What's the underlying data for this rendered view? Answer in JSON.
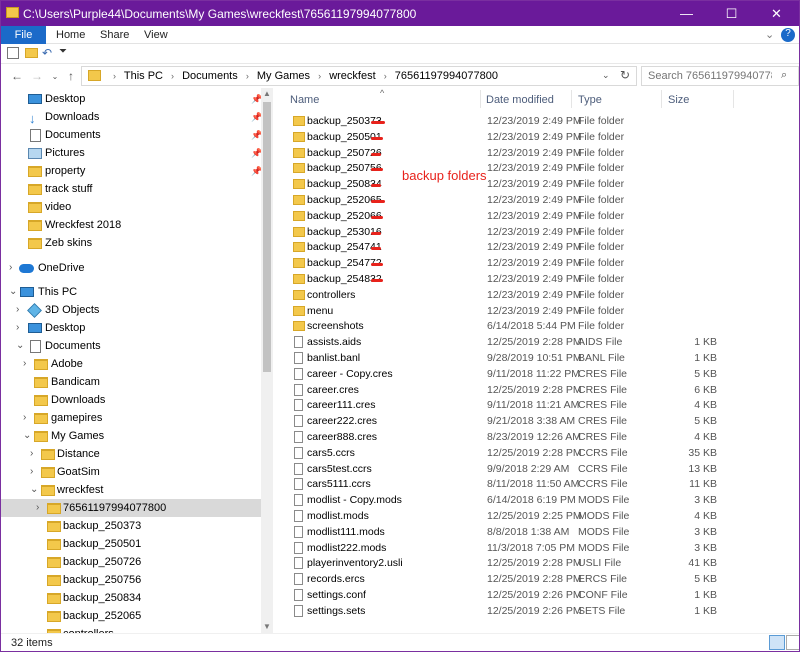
{
  "window": {
    "title": "C:\\Users\\Purple44\\Documents\\My Games\\wreckfest\\76561197994077800",
    "minimize_glyph": "—",
    "maximize_glyph": "☐",
    "close_glyph": "✕"
  },
  "ribbon": {
    "tabs": [
      "File",
      "Home",
      "Share",
      "View"
    ],
    "help_glyph": "?"
  },
  "breadcrumb": [
    "This PC",
    "Documents",
    "My Games",
    "wreckfest",
    "76561197994077800"
  ],
  "search": {
    "placeholder": "Search 76561197994077800"
  },
  "nav": {
    "quick_access": [
      {
        "label": "Desktop",
        "icon": "desktop-icon",
        "pinned": true
      },
      {
        "label": "Downloads",
        "icon": "download-icon",
        "pinned": true
      },
      {
        "label": "Documents",
        "icon": "documents-icon",
        "pinned": true
      },
      {
        "label": "Pictures",
        "icon": "pictures-icon",
        "pinned": true
      },
      {
        "label": "property",
        "icon": "folder-icon",
        "pinned": true
      },
      {
        "label": "track stuff",
        "icon": "folder-icon",
        "pinned": false
      },
      {
        "label": "video",
        "icon": "folder-icon",
        "pinned": false
      },
      {
        "label": "Wreckfest 2018",
        "icon": "folder-icon",
        "pinned": false
      },
      {
        "label": "Zeb skins",
        "icon": "folder-icon",
        "pinned": false
      }
    ],
    "onedrive": "OneDrive",
    "this_pc": "This PC",
    "tree": [
      {
        "label": "3D Objects",
        "icon": "3d-objects-icon"
      },
      {
        "label": "Desktop",
        "icon": "desktop-icon"
      },
      {
        "label": "Documents",
        "icon": "documents-icon"
      },
      {
        "label": "Adobe",
        "icon": "folder-icon"
      },
      {
        "label": "Bandicam",
        "icon": "folder-icon"
      },
      {
        "label": "Downloads",
        "icon": "folder-icon"
      },
      {
        "label": "gamepires",
        "icon": "folder-icon"
      },
      {
        "label": "My Games",
        "icon": "folder-icon"
      },
      {
        "label": "Distance",
        "icon": "folder-icon"
      },
      {
        "label": "GoatSim",
        "icon": "folder-icon"
      },
      {
        "label": "wreckfest",
        "icon": "folder-icon"
      },
      {
        "label": "76561197994077800",
        "icon": "folder-icon"
      },
      {
        "label": "backup_250373",
        "icon": "folder-icon"
      },
      {
        "label": "backup_250501",
        "icon": "folder-icon"
      },
      {
        "label": "backup_250726",
        "icon": "folder-icon"
      },
      {
        "label": "backup_250756",
        "icon": "folder-icon"
      },
      {
        "label": "backup_250834",
        "icon": "folder-icon"
      },
      {
        "label": "backup_252065",
        "icon": "folder-icon"
      },
      {
        "label": "controllers",
        "icon": "folder-icon"
      }
    ]
  },
  "columns": {
    "name": "Name",
    "date": "Date modified",
    "type": "Type",
    "size": "Size"
  },
  "files": [
    {
      "name": "backup_250373",
      "date": "12/23/2019 2:49 PM",
      "type": "File folder",
      "size": "",
      "kind": "folder"
    },
    {
      "name": "backup_250501",
      "date": "12/23/2019 2:49 PM",
      "type": "File folder",
      "size": "",
      "kind": "folder"
    },
    {
      "name": "backup_250726",
      "date": "12/23/2019 2:49 PM",
      "type": "File folder",
      "size": "",
      "kind": "folder"
    },
    {
      "name": "backup_250756",
      "date": "12/23/2019 2:49 PM",
      "type": "File folder",
      "size": "",
      "kind": "folder"
    },
    {
      "name": "backup_250834",
      "date": "12/23/2019 2:49 PM",
      "type": "File folder",
      "size": "",
      "kind": "folder"
    },
    {
      "name": "backup_252065",
      "date": "12/23/2019 2:49 PM",
      "type": "File folder",
      "size": "",
      "kind": "folder"
    },
    {
      "name": "backup_252066",
      "date": "12/23/2019 2:49 PM",
      "type": "File folder",
      "size": "",
      "kind": "folder"
    },
    {
      "name": "backup_253016",
      "date": "12/23/2019 2:49 PM",
      "type": "File folder",
      "size": "",
      "kind": "folder"
    },
    {
      "name": "backup_254741",
      "date": "12/23/2019 2:49 PM",
      "type": "File folder",
      "size": "",
      "kind": "folder"
    },
    {
      "name": "backup_254772",
      "date": "12/23/2019 2:49 PM",
      "type": "File folder",
      "size": "",
      "kind": "folder"
    },
    {
      "name": "backup_254832",
      "date": "12/23/2019 2:49 PM",
      "type": "File folder",
      "size": "",
      "kind": "folder"
    },
    {
      "name": "controllers",
      "date": "12/23/2019 2:49 PM",
      "type": "File folder",
      "size": "",
      "kind": "folder"
    },
    {
      "name": "menu",
      "date": "12/23/2019 2:49 PM",
      "type": "File folder",
      "size": "",
      "kind": "folder"
    },
    {
      "name": "screenshots",
      "date": "6/14/2018 5:44 PM",
      "type": "File folder",
      "size": "",
      "kind": "folder"
    },
    {
      "name": "assists.aids",
      "date": "12/25/2019 2:28 PM",
      "type": "AIDS File",
      "size": "1 KB",
      "kind": "file"
    },
    {
      "name": "banlist.banl",
      "date": "9/28/2019 10:51 PM",
      "type": "BANL File",
      "size": "1 KB",
      "kind": "file"
    },
    {
      "name": "career - Copy.cres",
      "date": "9/11/2018 11:22 PM",
      "type": "CRES File",
      "size": "5 KB",
      "kind": "file"
    },
    {
      "name": "career.cres",
      "date": "12/25/2019 2:28 PM",
      "type": "CRES File",
      "size": "6 KB",
      "kind": "file"
    },
    {
      "name": "career111.cres",
      "date": "9/11/2018 11:21 AM",
      "type": "CRES File",
      "size": "4 KB",
      "kind": "file"
    },
    {
      "name": "career222.cres",
      "date": "9/21/2018 3:38 AM",
      "type": "CRES File",
      "size": "5 KB",
      "kind": "file"
    },
    {
      "name": "career888.cres",
      "date": "8/23/2019 12:26 AM",
      "type": "CRES File",
      "size": "4 KB",
      "kind": "file"
    },
    {
      "name": "cars5.ccrs",
      "date": "12/25/2019 2:28 PM",
      "type": "CCRS File",
      "size": "35 KB",
      "kind": "file"
    },
    {
      "name": "cars5test.ccrs",
      "date": "9/9/2018 2:29 AM",
      "type": "CCRS File",
      "size": "13 KB",
      "kind": "file"
    },
    {
      "name": "cars5111.ccrs",
      "date": "8/11/2018 11:50 AM",
      "type": "CCRS File",
      "size": "11 KB",
      "kind": "file"
    },
    {
      "name": "modlist - Copy.mods",
      "date": "6/14/2018 6:19 PM",
      "type": "MODS File",
      "size": "3 KB",
      "kind": "file"
    },
    {
      "name": "modlist.mods",
      "date": "12/25/2019 2:25 PM",
      "type": "MODS File",
      "size": "4 KB",
      "kind": "file"
    },
    {
      "name": "modlist111.mods",
      "date": "8/8/2018 1:38 AM",
      "type": "MODS File",
      "size": "3 KB",
      "kind": "file"
    },
    {
      "name": "modlist222.mods",
      "date": "11/3/2018 7:05 PM",
      "type": "MODS File",
      "size": "3 KB",
      "kind": "file"
    },
    {
      "name": "playerinventory2.usli",
      "date": "12/25/2019 2:28 PM",
      "type": "USLI File",
      "size": "41 KB",
      "kind": "file"
    },
    {
      "name": "records.ercs",
      "date": "12/25/2019 2:28 PM",
      "type": "ERCS File",
      "size": "5 KB",
      "kind": "file"
    },
    {
      "name": "settings.conf",
      "date": "12/25/2019 2:26 PM",
      "type": "CONF File",
      "size": "1 KB",
      "kind": "file"
    },
    {
      "name": "settings.sets",
      "date": "12/25/2019 2:26 PM",
      "type": "SETS File",
      "size": "1 KB",
      "kind": "file"
    }
  ],
  "annotation": {
    "text": "backup folders",
    "color": "#e8221b"
  },
  "status": {
    "item_count": "32 items"
  },
  "colors": {
    "titlebar": "#6a1a9a",
    "file_tab": "#1b6ac9",
    "folder": "#f3c84b",
    "selection": "#d9d9d9"
  }
}
